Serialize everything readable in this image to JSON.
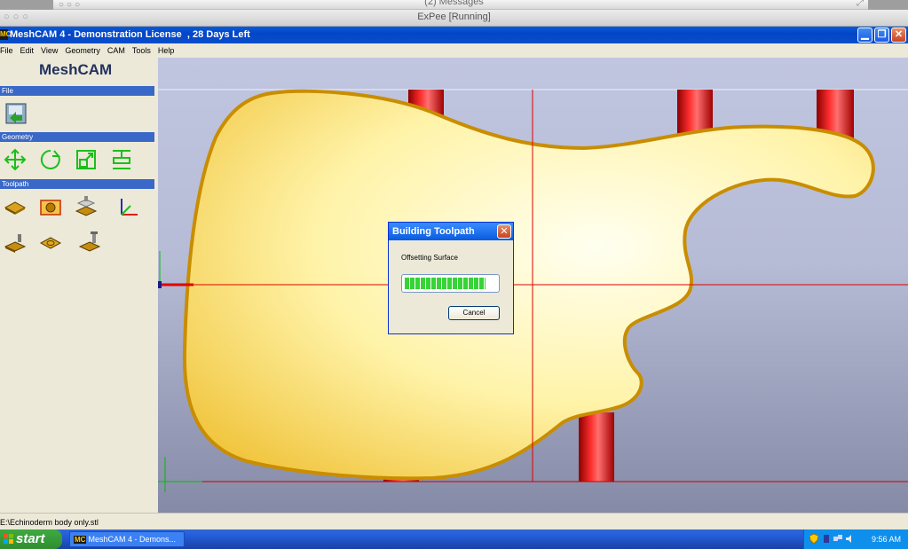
{
  "host": {
    "mac_top_title": "(2) Messages",
    "mac_window_title": "ExPee [Running]"
  },
  "window": {
    "app_badge": "MC",
    "title": "MeshCAM 4 - Demonstration License  , 28 Days Left"
  },
  "menu": [
    "File",
    "Edit",
    "View",
    "Geometry",
    "CAM",
    "Tools",
    "Help"
  ],
  "panel": {
    "brand": "MeshCAM",
    "sections": {
      "file": "File",
      "geometry": "Geometry",
      "toolpath": "Toolpath"
    }
  },
  "dialog": {
    "title": "Building Toolpath",
    "message": "Offsetting Surface",
    "progress": 0.88,
    "cancel_label": "Cancel"
  },
  "status": {
    "path": "E:\\Echinoderm body only.stl"
  },
  "taskbar": {
    "start_label": "start",
    "task_badge": "MC",
    "task_label": "MeshCAM 4 - Demons...",
    "clock": "9:56 AM"
  },
  "colors": {
    "xp_blue": "#0245c7",
    "panel_section": "#3a68c8",
    "progress_green": "#37d337",
    "crosshair_red": "#e00000"
  }
}
